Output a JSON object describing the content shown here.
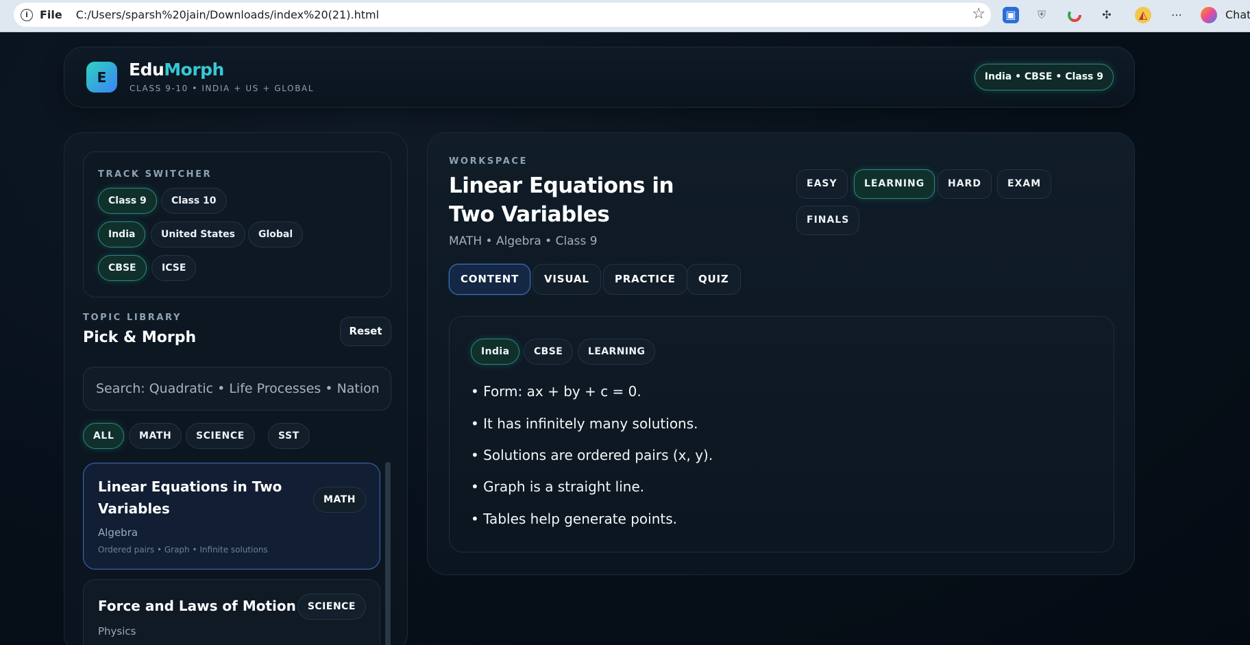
{
  "browser": {
    "file_label": "File",
    "url": "C:/Users/sparsh%20jain/Downloads/index%20(21).html",
    "chat_label": "Chat"
  },
  "header": {
    "logo_letter": "E",
    "brand_edu": "Edu",
    "brand_morph": "Morph",
    "subtitle": "CLASS 9-10 • INDIA + US + GLOBAL",
    "badge": "India • CBSE • Class 9"
  },
  "track_switcher": {
    "kicker": "TRACK SWITCHER",
    "classes": [
      "Class 9",
      "Class 10"
    ],
    "regions": [
      "India",
      "United States",
      "Global"
    ],
    "boards": [
      "CBSE",
      "ICSE"
    ]
  },
  "library": {
    "kicker": "TOPIC LIBRARY",
    "title": "Pick & Morph",
    "reset_label": "Reset",
    "search_placeholder": "Search: Quadratic • Life Processes • National",
    "filters": [
      "ALL",
      "MATH",
      "SCIENCE",
      "SST"
    ],
    "topics": [
      {
        "title_line1": "Linear Equations in Two",
        "title_line2": "Variables",
        "subtopic": "Algebra",
        "tags": "Ordered pairs • Graph • Infinite solutions",
        "subject": "MATH"
      },
      {
        "title_line1": "Force and Laws of Motion",
        "subtopic": "Physics",
        "tags": "",
        "subject": "SCIENCE"
      }
    ]
  },
  "workspace": {
    "kicker": "WORKSPACE",
    "title": "Linear Equations in Two Variables",
    "meta": "MATH • Algebra • Class 9",
    "difficulty": [
      "EASY",
      "LEARNING",
      "HARD",
      "EXAM",
      "FINALS"
    ],
    "modes": [
      "CONTENT",
      "VISUAL",
      "PRACTICE",
      "QUIZ"
    ],
    "content_tags": [
      "India",
      "CBSE",
      "LEARNING"
    ],
    "bullets": [
      "• Form: ax + by + c = 0.",
      "• It has infinitely many solutions.",
      "• Solutions are ordered pairs (x, y).",
      "• Graph is a straight line.",
      "• Tables help generate points."
    ]
  }
}
